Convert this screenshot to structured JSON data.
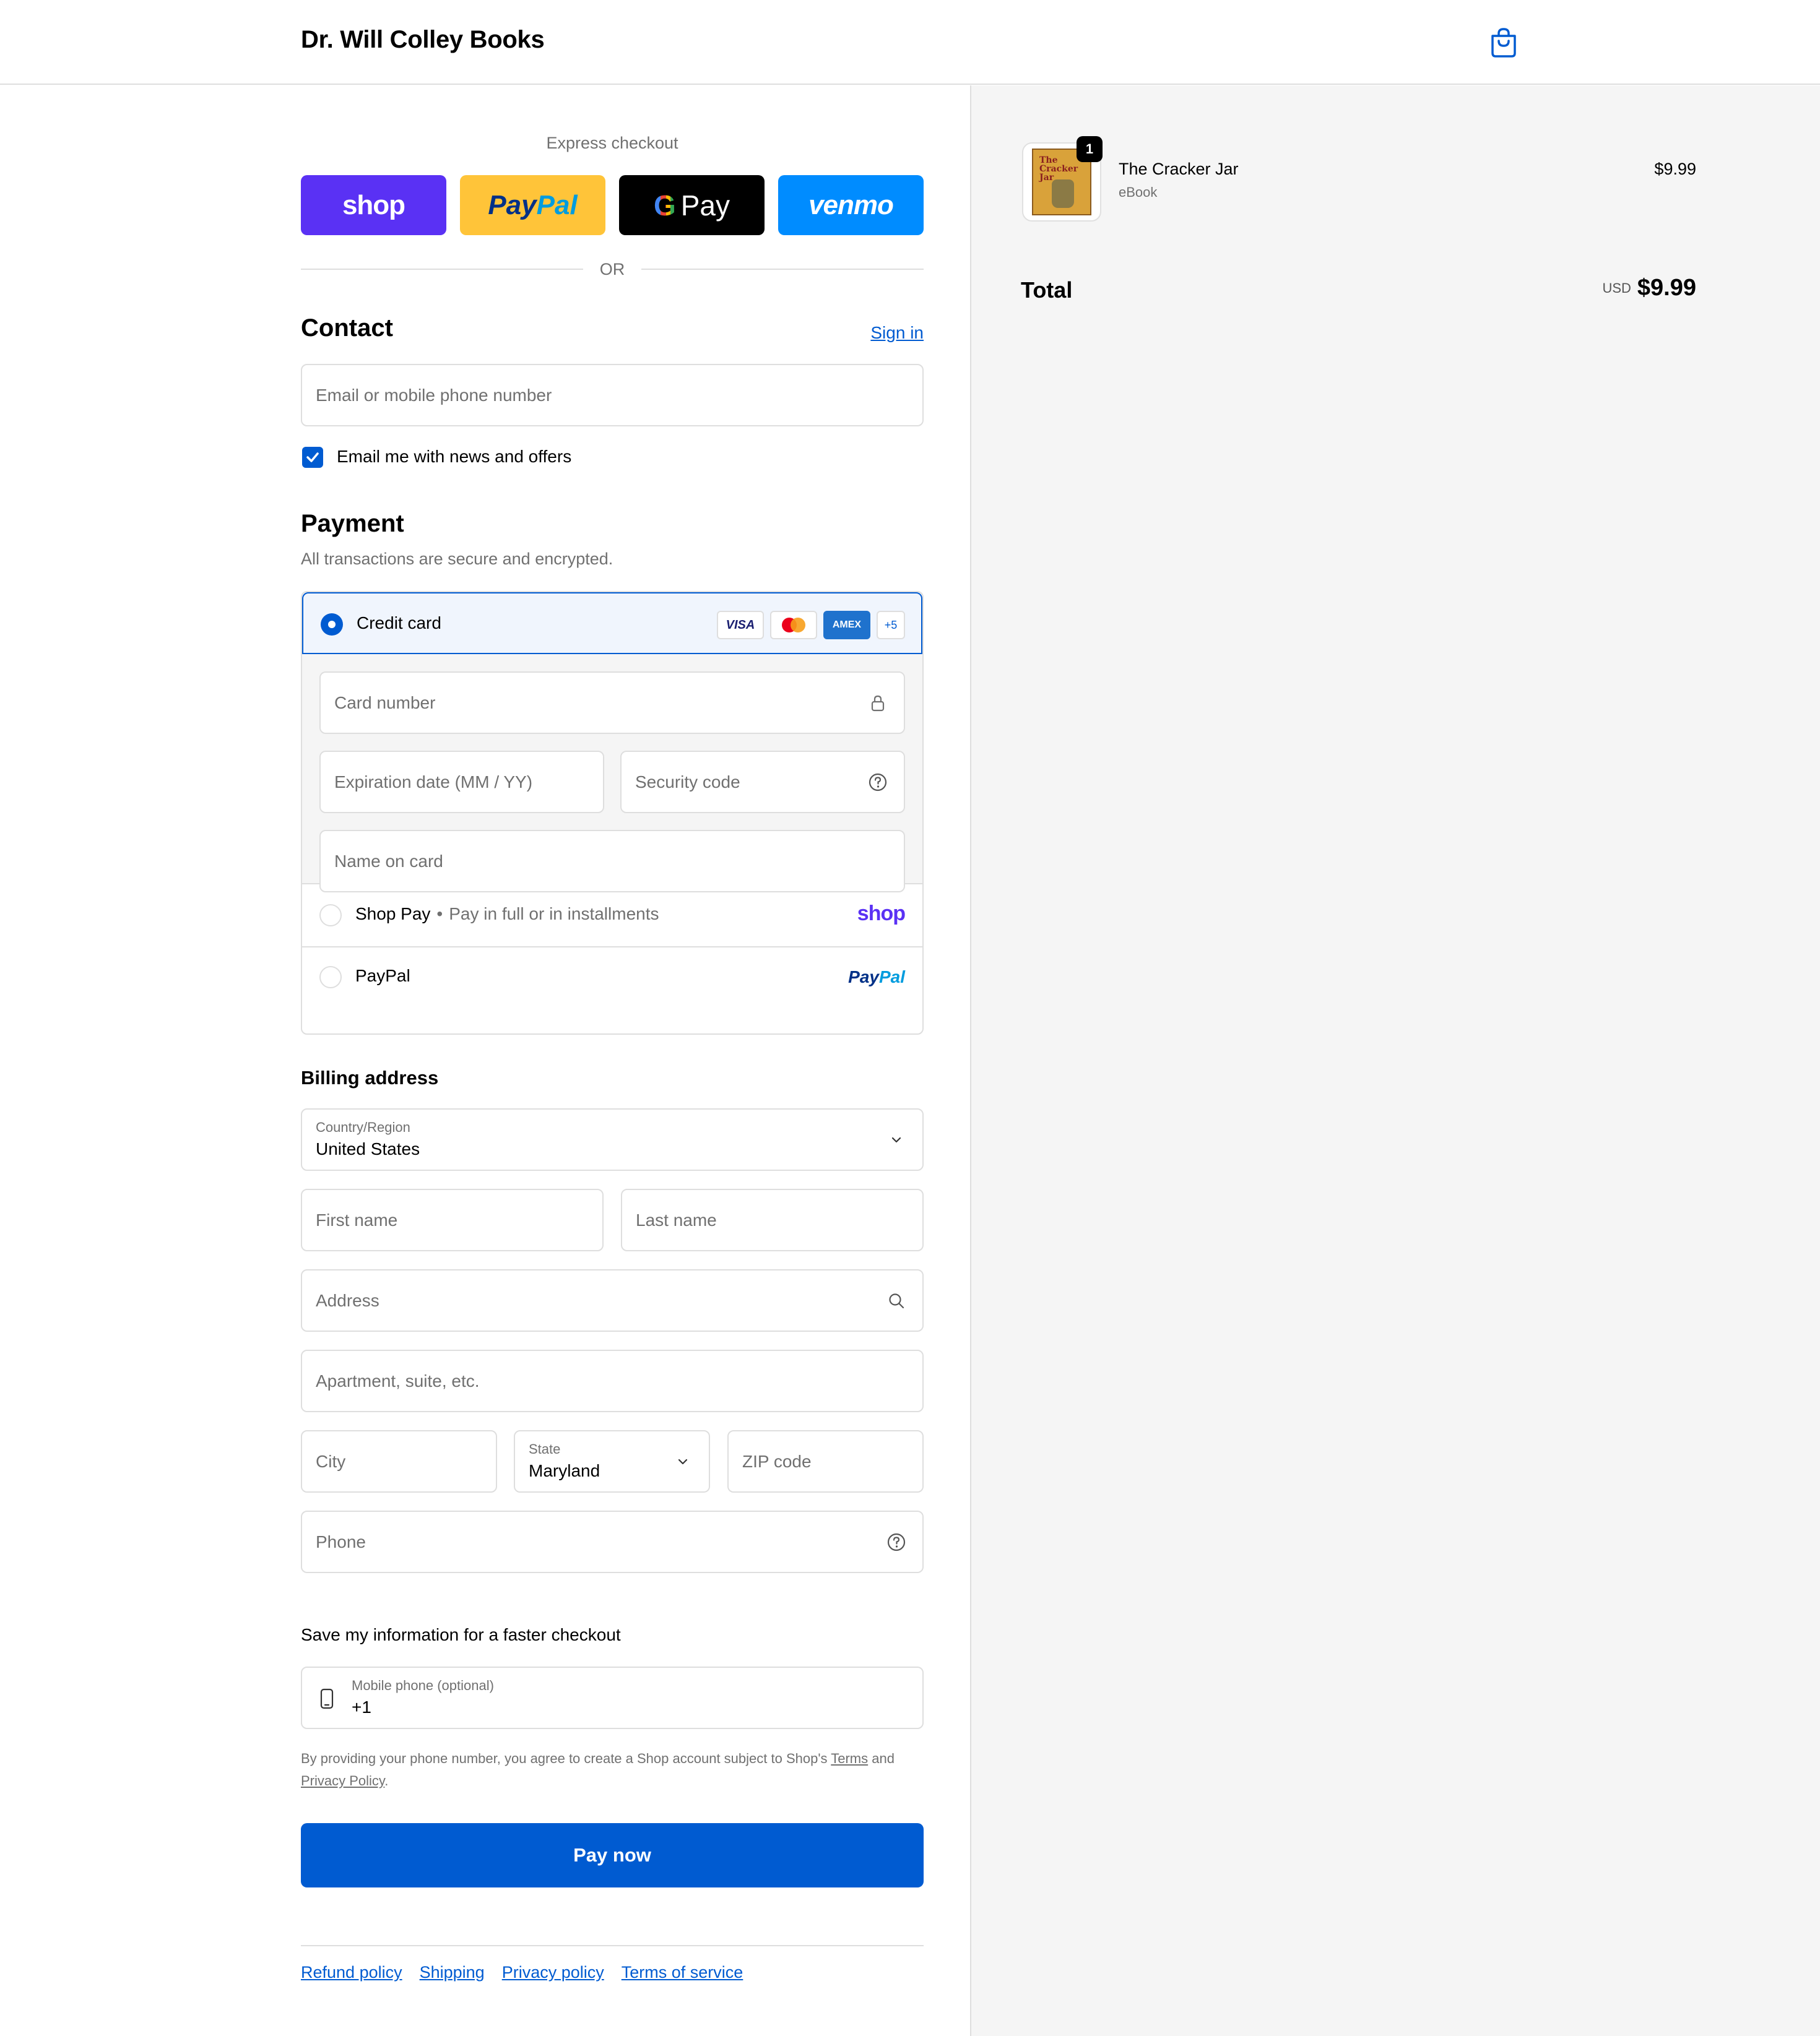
{
  "header": {
    "shop_name": "Dr. Will Colley Books",
    "cart_icon": "shopping-bag-icon"
  },
  "express": {
    "label": "Express checkout",
    "buttons": {
      "shop": "shop",
      "paypal_a": "Pay",
      "paypal_b": "Pal",
      "gpay_g": "G",
      "gpay": "Pay",
      "venmo": "venmo"
    },
    "or": "OR"
  },
  "contact": {
    "title": "Contact",
    "sign_in": "Sign in",
    "email_placeholder": "Email or mobile phone number",
    "news_checkbox": "Email me with news and offers",
    "news_checked": true
  },
  "payment": {
    "title": "Payment",
    "subtitle": "All transactions are secure and encrypted.",
    "credit_card": "Credit card",
    "card_logos": {
      "visa": "VISA",
      "amex": "AMEX",
      "more": "+5"
    },
    "card_number": "Card number",
    "expiration": "Expiration date (MM / YY)",
    "security": "Security code",
    "name_on_card": "Name on card",
    "shop_pay": "Shop Pay",
    "shop_pay_dot": "•",
    "shop_pay_sub": "Pay in full or in installments",
    "shop_brand": "shop",
    "paypal": "PayPal",
    "paypal_brand_a": "Pay",
    "paypal_brand_b": "Pal"
  },
  "billing": {
    "title": "Billing address",
    "country_label": "Country/Region",
    "country_value": "United States",
    "first_name": "First name",
    "last_name": "Last name",
    "address": "Address",
    "apartment": "Apartment, suite, etc.",
    "city": "City",
    "state_label": "State",
    "state_value": "Maryland",
    "zip": "ZIP code",
    "phone": "Phone"
  },
  "save_info": {
    "title": "Save my information for a faster checkout",
    "mobile_label": "Mobile phone (optional)",
    "mobile_value": "+1",
    "fine_prefix": "By providing your phone number, you agree to create a Shop account subject to Shop's",
    "terms": "Terms",
    "and": "and",
    "privacy": "Privacy Policy",
    "period": "."
  },
  "pay_now": "Pay now",
  "footer_links": [
    "Refund policy",
    "Shipping",
    "Privacy policy",
    "Terms of service"
  ],
  "summary": {
    "quantity": "1",
    "product_name": "The Cracker Jar",
    "product_type": "eBook",
    "product_price": "$9.99",
    "cover_title": "The Cracker Jar",
    "total_label": "Total",
    "currency": "USD",
    "total": "$9.99"
  },
  "colors": {
    "accent": "#005bd1",
    "shop_purple": "#5a31f4",
    "paypal_yellow": "#ffc439",
    "venmo_blue": "#008cff"
  }
}
